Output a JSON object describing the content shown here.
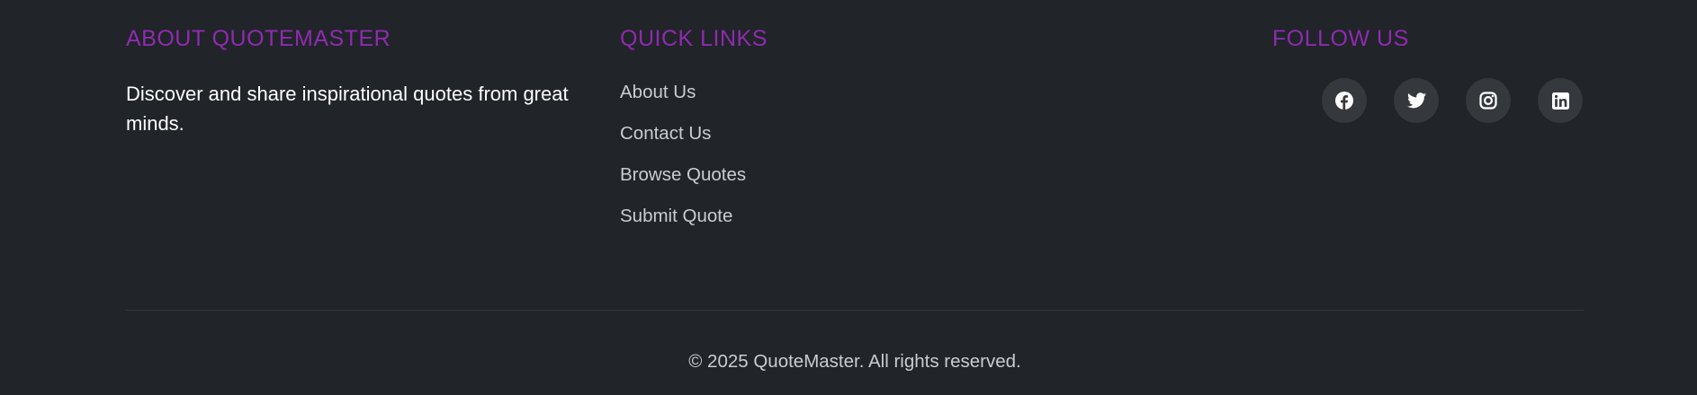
{
  "about": {
    "heading": "ABOUT QUOTEMASTER",
    "text": "Discover and share inspirational quotes from great minds."
  },
  "quick_links": {
    "heading": "QUICK LINKS",
    "items": [
      {
        "label": "About Us"
      },
      {
        "label": "Contact Us"
      },
      {
        "label": "Browse Quotes"
      },
      {
        "label": "Submit Quote"
      }
    ]
  },
  "follow": {
    "heading": "FOLLOW US",
    "icons": [
      "facebook-icon",
      "twitter-icon",
      "instagram-icon",
      "linkedin-icon"
    ]
  },
  "copyright": "© 2025 QuoteMaster. All rights reserved.",
  "colors": {
    "background": "#212429",
    "heading": "#8f2bb0",
    "link": "#c9ccd1",
    "social_bg": "#35383d"
  }
}
